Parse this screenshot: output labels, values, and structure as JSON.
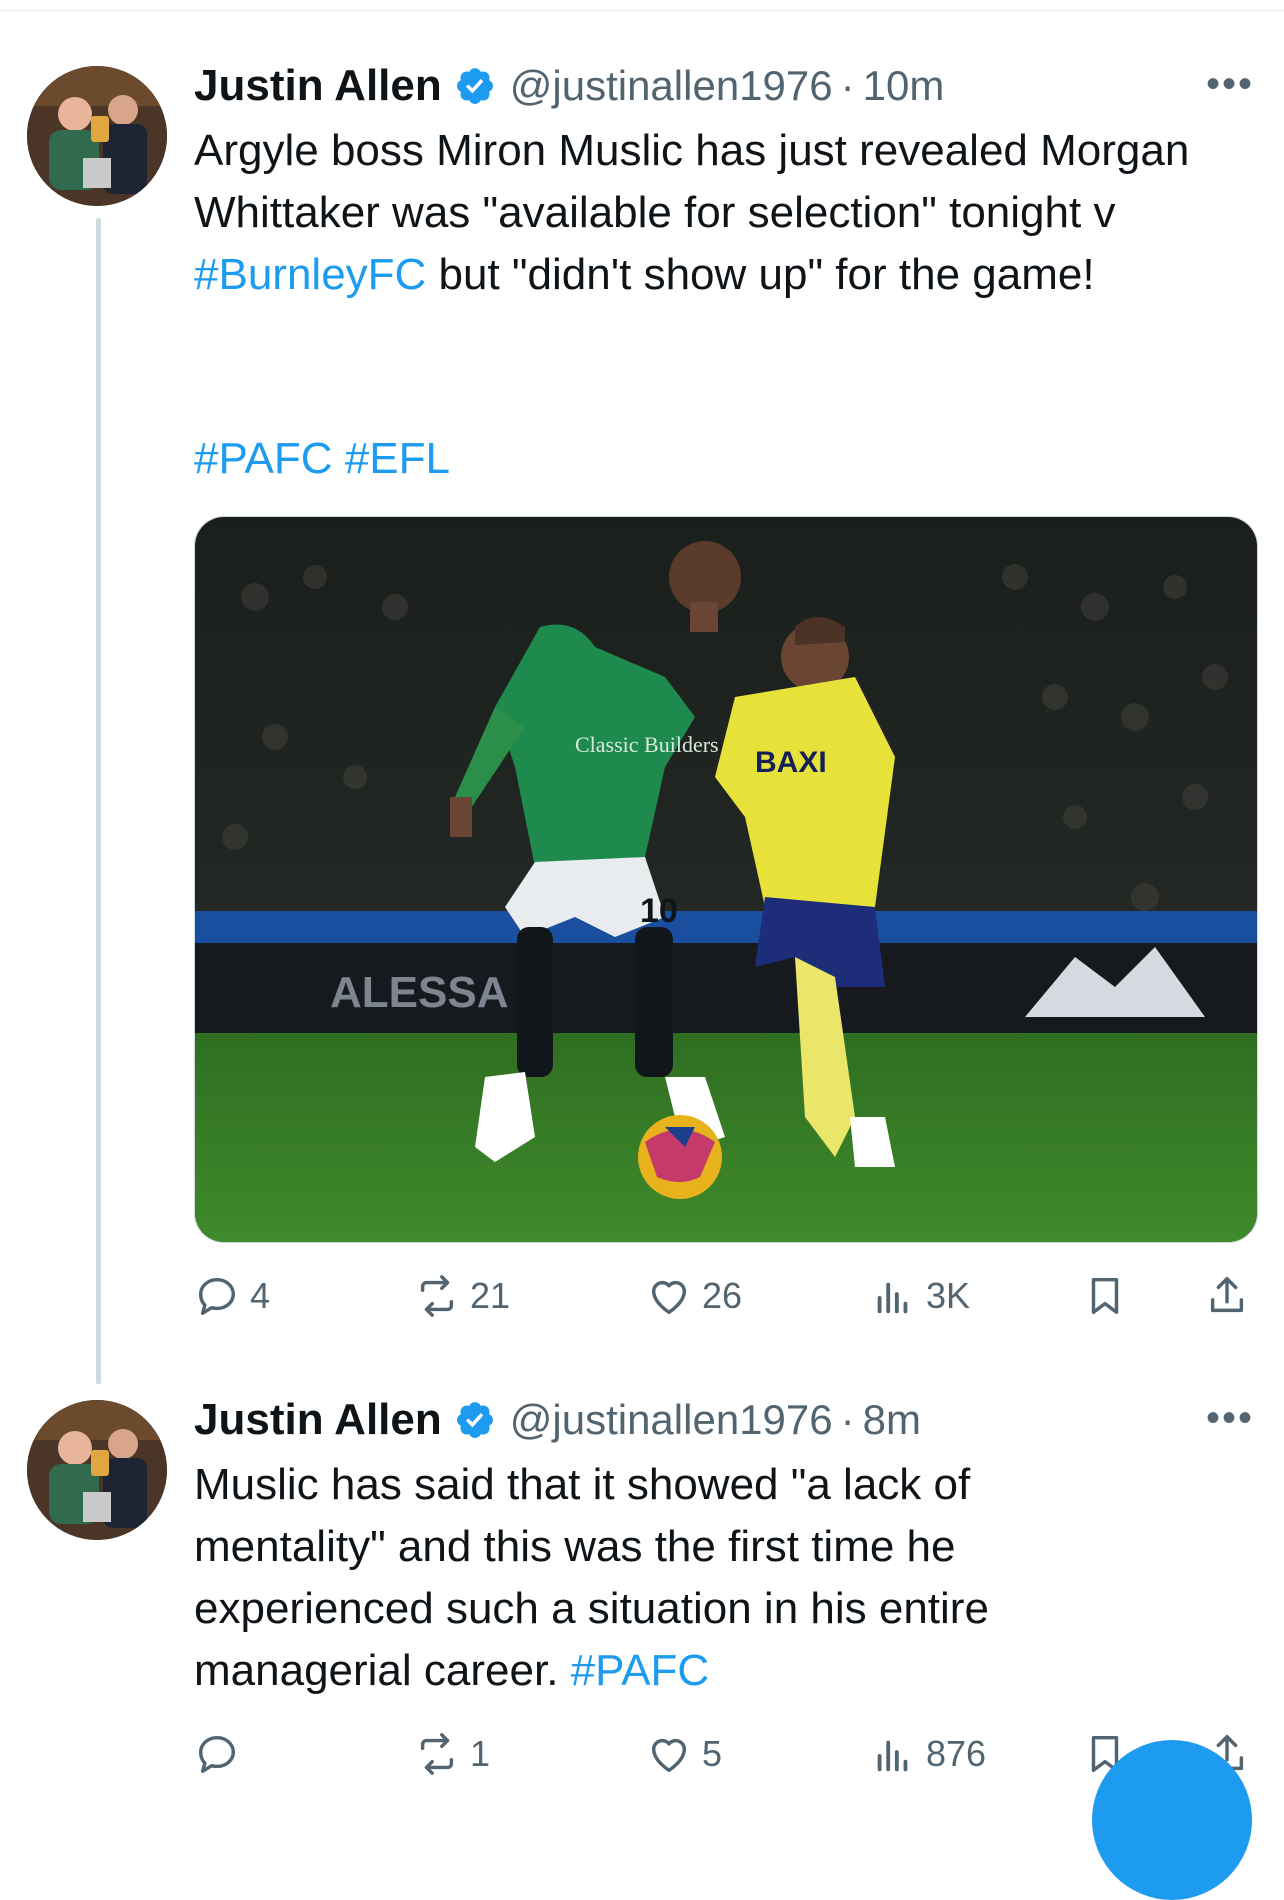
{
  "tweets": [
    {
      "author": {
        "name": "Justin Allen",
        "handle": "@justinallen1976",
        "verified_icon": "verified-badge-icon"
      },
      "time": "10m",
      "text": [
        {
          "t": "Argyle boss Miron Muslic has just revealed Morgan Whittaker was \"available for selection\" tonight v ",
          "tag": false
        },
        {
          "t": "#BurnleyFC",
          "tag": true
        },
        {
          "t": " but \"didn't show up\" for the game!",
          "tag": false
        }
      ],
      "hashtags_line": "#PAFC #EFL",
      "media": {
        "shirt_sponsor_green": "Classic Builders",
        "shirt_sponsor_yellow": "BAXI",
        "shirt_number": "10",
        "board_text": "ALESSA"
      },
      "stats": {
        "replies": "4",
        "reposts": "21",
        "likes": "26",
        "views": "3K"
      }
    },
    {
      "author": {
        "name": "Justin Allen",
        "handle": "@justinallen1976",
        "verified_icon": "verified-badge-icon"
      },
      "time": "8m",
      "text": [
        {
          "t": "Muslic has said that it showed \"a lack of mentality\" and this was the first time he experienced such a situation in his entire managerial career. ",
          "tag": false
        },
        {
          "t": "#PAFC",
          "tag": true
        }
      ],
      "stats": {
        "replies": "",
        "reposts": "1",
        "likes": "5",
        "views": "876"
      }
    }
  ],
  "ui": {
    "more_glyph": "•••",
    "separator": "·",
    "colors": {
      "link": "#1d9bf0",
      "muted": "#536471",
      "verified": "#1d9bf0"
    }
  }
}
